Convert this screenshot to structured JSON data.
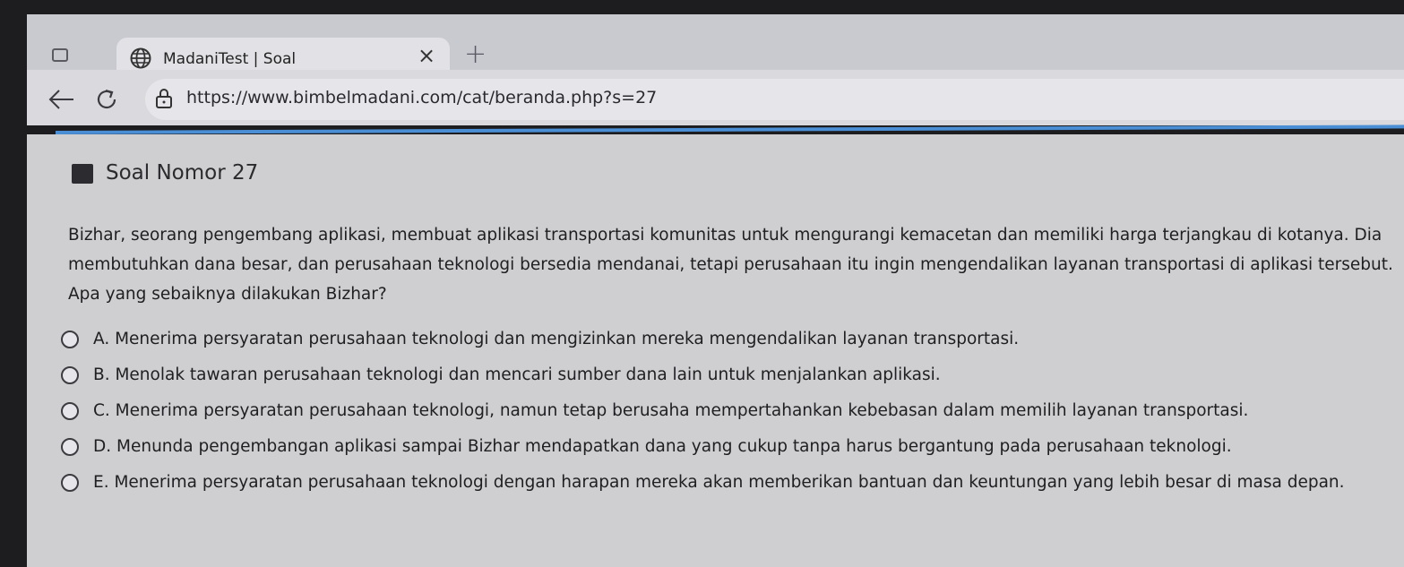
{
  "browser": {
    "tab_title": "MadaniTest | Soal",
    "tab_close": "×",
    "new_tab": "+",
    "url": "https://www.bimbelmadani.com/cat/beranda.php?s=27"
  },
  "question": {
    "title": "Soal Nomor 27",
    "text": "Bizhar, seorang pengembang aplikasi, membuat aplikasi transportasi komunitas untuk mengurangi kemacetan dan memiliki harga terjangkau di kotanya. Dia membutuhkan dana besar, dan perusahaan teknologi bersedia mendanai, tetapi perusahaan itu ingin mengendalikan layanan transportasi di aplikasi tersebut. Apa yang sebaiknya dilakukan Bizhar?",
    "options": [
      {
        "label": "A. Menerima persyaratan perusahaan teknologi dan mengizinkan mereka mengendalikan layanan transportasi."
      },
      {
        "label": "B. Menolak tawaran perusahaan teknologi dan mencari sumber dana lain untuk menjalankan aplikasi."
      },
      {
        "label": "C. Menerima persyaratan perusahaan teknologi, namun tetap berusaha mempertahankan kebebasan dalam memilih layanan transportasi."
      },
      {
        "label": "D. Menunda pengembangan aplikasi sampai Bizhar mendapatkan dana yang cukup tanpa harus bergantung pada perusahaan teknologi."
      },
      {
        "label": "E. Menerima persyaratan perusahaan teknologi dengan harapan mereka akan memberikan bantuan dan keuntungan yang lebih besar di masa depan."
      }
    ]
  },
  "icons": {
    "tab_actions": "tab-actions-icon",
    "favicon": "globe-icon",
    "back": "back-arrow-icon",
    "reload": "reload-icon",
    "site_info": "lock-icon",
    "question": "question-flag-icon"
  }
}
